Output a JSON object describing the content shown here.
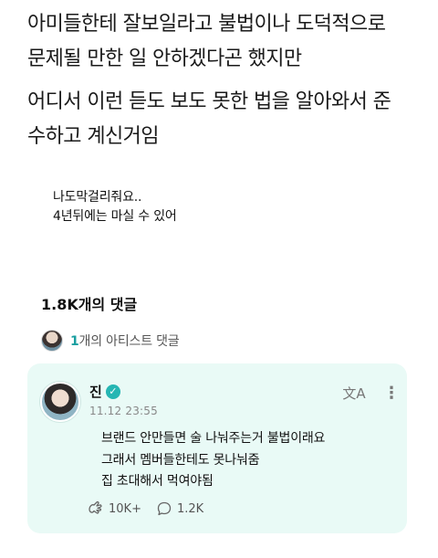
{
  "caption": {
    "line1": "아미들한테 잘보일라고 불법이나 도덕적으로",
    "line2": "문제될 만한 일 안하겠다곤 했지만",
    "line3": "어디서 이런 듣도 보도 못한 법을 알아와서 준",
    "line4": "수하고 계신거임"
  },
  "quote": {
    "line1": "나도막걸리줘요..",
    "line2": "4년뒤에는 마실 수 있어"
  },
  "comments": {
    "count_label": "1.8K개의 댓글",
    "artist_count": "1",
    "artist_suffix": "개의 아티스트 댓글"
  },
  "artist_comment": {
    "author": "진",
    "verified_icon": "✓",
    "timestamp": "11.12 23:55",
    "translate_icon": "文A",
    "more_icon": "⋮",
    "lines": [
      "브랜드 안만들면 술 나눠주는거 불법이래요",
      "그래서 멤버들한테도 못나눠줌",
      "집 초대해서 먹여야됨"
    ],
    "likes": "10K+",
    "replies": "1.2K",
    "accent_color": "#25b6b3",
    "card_color": "#e9faf6"
  }
}
